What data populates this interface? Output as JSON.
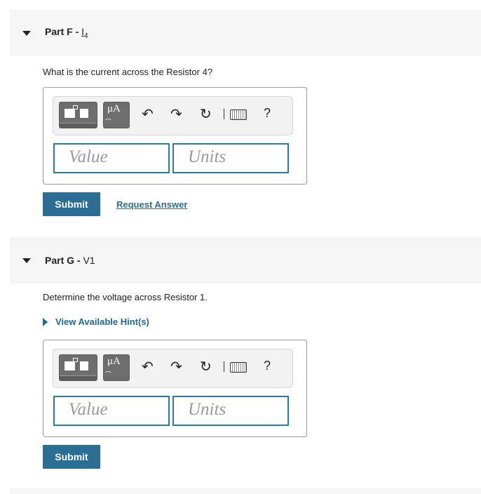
{
  "partF": {
    "label": "Part F - ",
    "var_letter": "I",
    "var_sub": "4",
    "question": "What is the current across the Resistor 4?",
    "value_placeholder": "Value",
    "units_placeholder": "Units",
    "submit": "Submit",
    "request_answer": "Request Answer"
  },
  "partG": {
    "label": "Part G - ",
    "var": "V1",
    "question": "Determine the voltage across Resistor 1.",
    "hint": "View Available Hint(s)",
    "value_placeholder": "Value",
    "units_placeholder": "Units",
    "submit": "Submit"
  },
  "toolbar": {
    "mu_label": "μA",
    "undo": "↶",
    "redo": "↷",
    "reset": "↻",
    "help": "?",
    "icons": [
      "templates-icon",
      "units-icon",
      "undo-icon",
      "redo-icon",
      "reset-icon",
      "keyboard-icon",
      "help-icon"
    ]
  },
  "colors": {
    "accent": "#2b6d94",
    "field_border": "#2d7aa0",
    "header_bg": "#f5f5f5"
  }
}
